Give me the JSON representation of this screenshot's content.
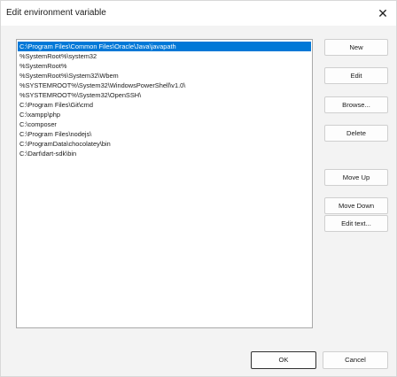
{
  "window": {
    "title": "Edit environment variable",
    "close_glyph": "✕"
  },
  "list": {
    "selected_index": 0,
    "items": [
      "C:\\Program Files\\Common Files\\Oracle\\Java\\javapath",
      "%SystemRoot%\\system32",
      "%SystemRoot%",
      "%SystemRoot%\\System32\\Wbem",
      "%SYSTEMROOT%\\System32\\WindowsPowerShell\\v1.0\\",
      "%SYSTEMROOT%\\System32\\OpenSSH\\",
      "C:\\Program Files\\Git\\cmd",
      "C:\\xampp\\php",
      "C:\\composer",
      "C:\\Program Files\\nodejs\\",
      "C:\\ProgramData\\chocolatey\\bin",
      "C:\\Dart\\dart-sdk\\bin"
    ]
  },
  "buttons": {
    "new": "New",
    "edit": "Edit",
    "browse": "Browse...",
    "delete": "Delete",
    "move_up": "Move Up",
    "move_down": "Move Down",
    "edit_text": "Edit text...",
    "ok": "OK",
    "cancel": "Cancel"
  }
}
